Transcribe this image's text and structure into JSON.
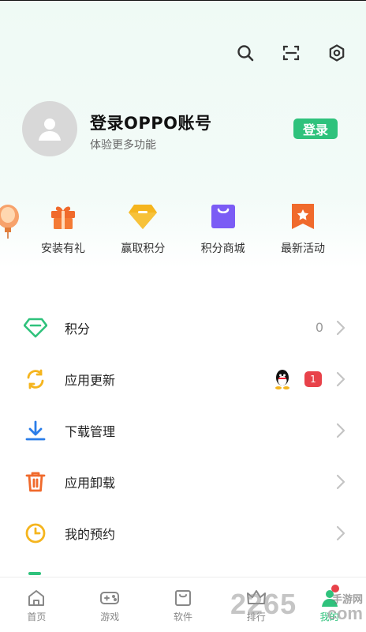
{
  "header": {
    "icons": [
      "search-icon",
      "scan-icon",
      "settings-icon"
    ]
  },
  "profile": {
    "name": "登录OPPO账号",
    "subtitle": "体验更多功能",
    "login_label": "登录"
  },
  "quick_actions": [
    {
      "label": "安装有礼",
      "icon": "gift-icon",
      "color": "#f06a2c"
    },
    {
      "label": "赢取积分",
      "icon": "diamond-icon",
      "color": "#f5b51e"
    },
    {
      "label": "积分商城",
      "icon": "shopping-bag-icon",
      "color": "#7b5cf5"
    },
    {
      "label": "最新活动",
      "icon": "star-flag-icon",
      "color": "#f06a2c"
    }
  ],
  "menu": [
    {
      "label": "积分",
      "icon": "gem-icon",
      "value": "0"
    },
    {
      "label": "应用更新",
      "icon": "refresh-icon",
      "badge": "1"
    },
    {
      "label": "下载管理",
      "icon": "download-icon"
    },
    {
      "label": "应用卸载",
      "icon": "trash-icon"
    },
    {
      "label": "我的预约",
      "icon": "clock-icon"
    }
  ],
  "bottom_nav": [
    {
      "label": "首页",
      "icon": "home-icon"
    },
    {
      "label": "游戏",
      "icon": "gamepad-icon"
    },
    {
      "label": "软件",
      "icon": "app-box-icon"
    },
    {
      "label": "排行",
      "icon": "crown-icon"
    },
    {
      "label": "我的",
      "icon": "person-icon",
      "active": true
    }
  ],
  "watermark": {
    "number": "2265",
    "text": "手游网",
    "com": "com"
  },
  "colors": {
    "accent": "#2fc27c",
    "badge": "#e8424a"
  }
}
